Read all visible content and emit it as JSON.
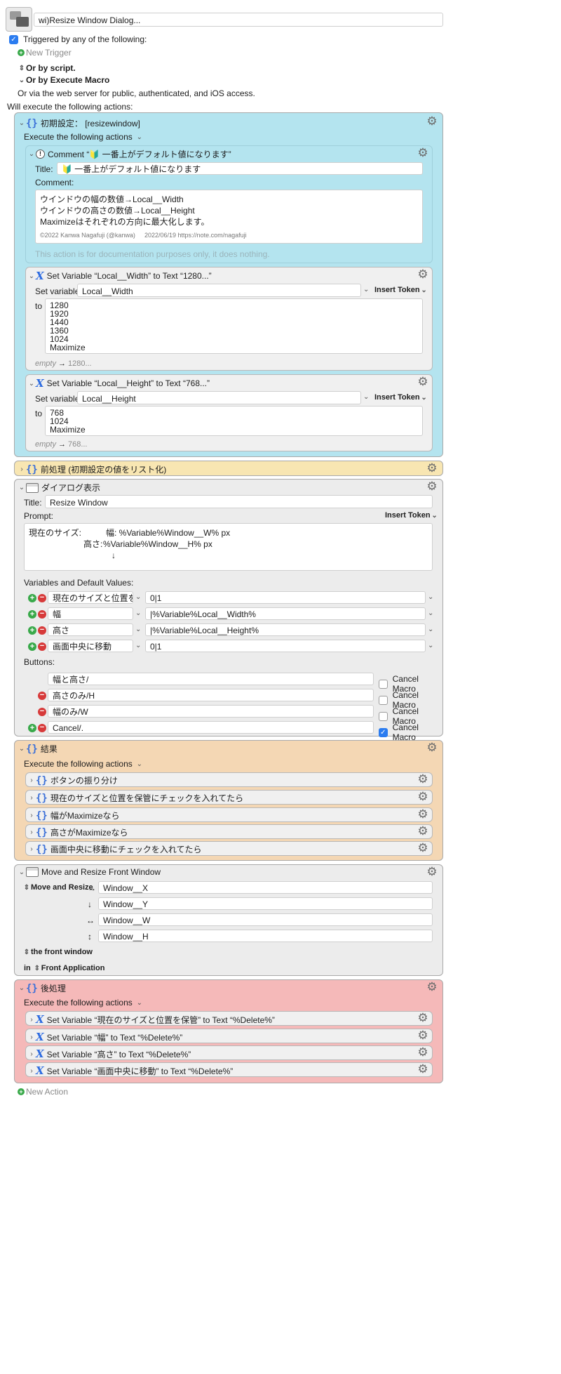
{
  "header": {
    "macro_name": "wi)Resize Window Dialog...",
    "triggered_label": "Triggered by any of the following:",
    "new_trigger": "New Trigger",
    "or_by_script": "Or by script.",
    "or_by_execute_macro": "Or by Execute Macro",
    "web_server": "Or via the web server for public, authenticated, and iOS access.",
    "will_execute": "Will execute the following actions:"
  },
  "group1": {
    "title": "初期設定： [resizewindow]",
    "execute": "Execute the following actions",
    "comment": {
      "header": "Comment “🔰 一番上がデフォルト値になります”",
      "title_label": "Title:",
      "title_value": "🔰 一番上がデフォルト値になります",
      "comment_label": "Comment:",
      "lines": [
        "ウインドウの幅の数値→Local__Width",
        "ウインドウの高さの数値→Local__Height",
        "Maximizeはそれぞれの方向に最大化します。"
      ],
      "footer_left": "©2022 Kanwa Nagafuji (@kanwa)",
      "footer_right": "2022/06/19 https://note.com/nagafuji",
      "doc_note": "This action is for documentation purposes only, it does nothing."
    },
    "setvar1": {
      "header": "Set Variable “Local__Width” to Text “1280...”",
      "set_variable_label": "Set variable",
      "variable": "Local__Width",
      "insert_token": "Insert Token",
      "to_label": "to",
      "lines": [
        "1280",
        "1920",
        "1440",
        "1360",
        "1024",
        "Maximize"
      ],
      "empty": "empty",
      "arrow": "→",
      "result": "1280..."
    },
    "setvar2": {
      "header": "Set Variable “Local__Height” to Text “768...”",
      "set_variable_label": "Set variable",
      "variable": "Local__Height",
      "insert_token": "Insert Token",
      "to_label": "to",
      "lines": [
        "768",
        "1024",
        "Maximize"
      ],
      "empty": "empty",
      "arrow": "→",
      "result": "768..."
    }
  },
  "group2": {
    "title": "前処理 (初期設定の値をリスト化)"
  },
  "dialog": {
    "title_text": "ダイアログ表示",
    "title_label": "Title:",
    "title_value": "Resize Window",
    "prompt_label": "Prompt:",
    "insert_token": "Insert Token",
    "prompt_line1_label": "現在のサイズ:",
    "prompt_line1_value": "幅:  %Variable%Window__W% px",
    "prompt_line2_label": "高さ:",
    "prompt_line2_value": "%Variable%Window__H% px",
    "prompt_line3": "↓",
    "variables_label": "Variables and Default Values:",
    "variables": [
      {
        "name": "現在のサイズと位置を保管",
        "value": "0|1"
      },
      {
        "name": "幅",
        "value": "|%Variable%Local__Width%"
      },
      {
        "name": "高さ",
        "value": "|%Variable%Local__Height%"
      },
      {
        "name": "画面中央に移動",
        "value": "0|1"
      }
    ],
    "buttons_label": "Buttons:",
    "buttons": [
      {
        "label": "幅と高さ/",
        "cancel": "Cancel Macro",
        "checked": false
      },
      {
        "label": "高さのみ/H",
        "cancel": "Cancel Macro",
        "checked": false
      },
      {
        "label": "幅のみ/W",
        "cancel": "Cancel Macro",
        "checked": false
      },
      {
        "label": "Cancel/.",
        "cancel": "Cancel Macro",
        "checked": true
      }
    ]
  },
  "results": {
    "title": "結果",
    "execute": "Execute the following actions",
    "items": [
      "ボタンの振り分け",
      "現在のサイズと位置を保管にチェックを入れてたら",
      "幅がMaximizeなら",
      "高さがMaximizeなら",
      "画面中央に移動にチェックを入れてたら"
    ]
  },
  "move": {
    "title": "Move and Resize Front Window",
    "mode": "Move and Resize",
    "fields": [
      {
        "icon": "→",
        "value": "Window__X"
      },
      {
        "icon": "↓",
        "value": "Window__Y"
      },
      {
        "icon": "↔",
        "value": "Window__W"
      },
      {
        "icon": "↕",
        "value": "Window__H"
      }
    ],
    "front_window": "the front window",
    "in_label": "in",
    "application": "Front Application"
  },
  "post": {
    "title": "後処理",
    "execute": "Execute the following actions",
    "items": [
      "Set Variable “現在のサイズと位置を保管” to Text “%Delete%”",
      "Set Variable “幅” to Text “%Delete%”",
      "Set Variable “高さ” to Text “%Delete%”",
      "Set Variable “画面中央に移動” to Text “%Delete%”"
    ]
  },
  "footer": {
    "new_action": "New Action"
  },
  "colors": {
    "cyan": "#b4e4ef",
    "yellow": "#f8e6b2",
    "gray": "#ececec",
    "orange": "#f4d7b4",
    "pink": "#f5b9b9"
  }
}
